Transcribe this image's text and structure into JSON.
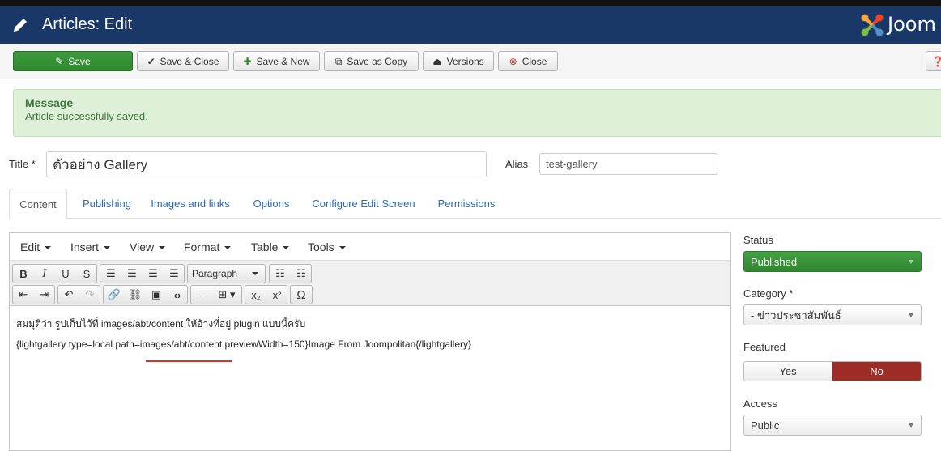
{
  "header": {
    "title": "Articles: Edit",
    "logo_text": "Joom"
  },
  "toolbar": {
    "save": "Save",
    "save_close": "Save & Close",
    "save_new": "Save & New",
    "save_copy": "Save as Copy",
    "versions": "Versions",
    "close": "Close"
  },
  "message": {
    "heading": "Message",
    "text": "Article successfully saved."
  },
  "form": {
    "title_label": "Title *",
    "title_value": "ตัวอย่าง Gallery",
    "alias_label": "Alias",
    "alias_value": "test-gallery"
  },
  "tabs": [
    "Content",
    "Publishing",
    "Images and links",
    "Options",
    "Configure Edit Screen",
    "Permissions"
  ],
  "editor": {
    "menus": [
      "Edit",
      "Insert",
      "View",
      "Format",
      "Table",
      "Tools"
    ],
    "paragraph_select": "Paragraph",
    "line1": "สมมุติว่า รูปเก็บไว้ที่ images/abt/content ให้อ้างที่อยู่  plugin  แบบนี้ครับ",
    "line2": "{lightgallery type=local path=images/abt/content previewWidth=150}Image From Joompolitan{/lightgallery}"
  },
  "sidebar": {
    "status_label": "Status",
    "status_value": "Published",
    "category_label": "Category *",
    "category_value": "- ข่าวประชาสัมพันธ์",
    "featured_label": "Featured",
    "featured_yes": "Yes",
    "featured_no": "No",
    "access_label": "Access",
    "access_value": "Public"
  },
  "colors": {
    "header": "#1a3867",
    "success": "#2f882f",
    "danger": "#9c2c25",
    "link": "#2a69b8"
  }
}
